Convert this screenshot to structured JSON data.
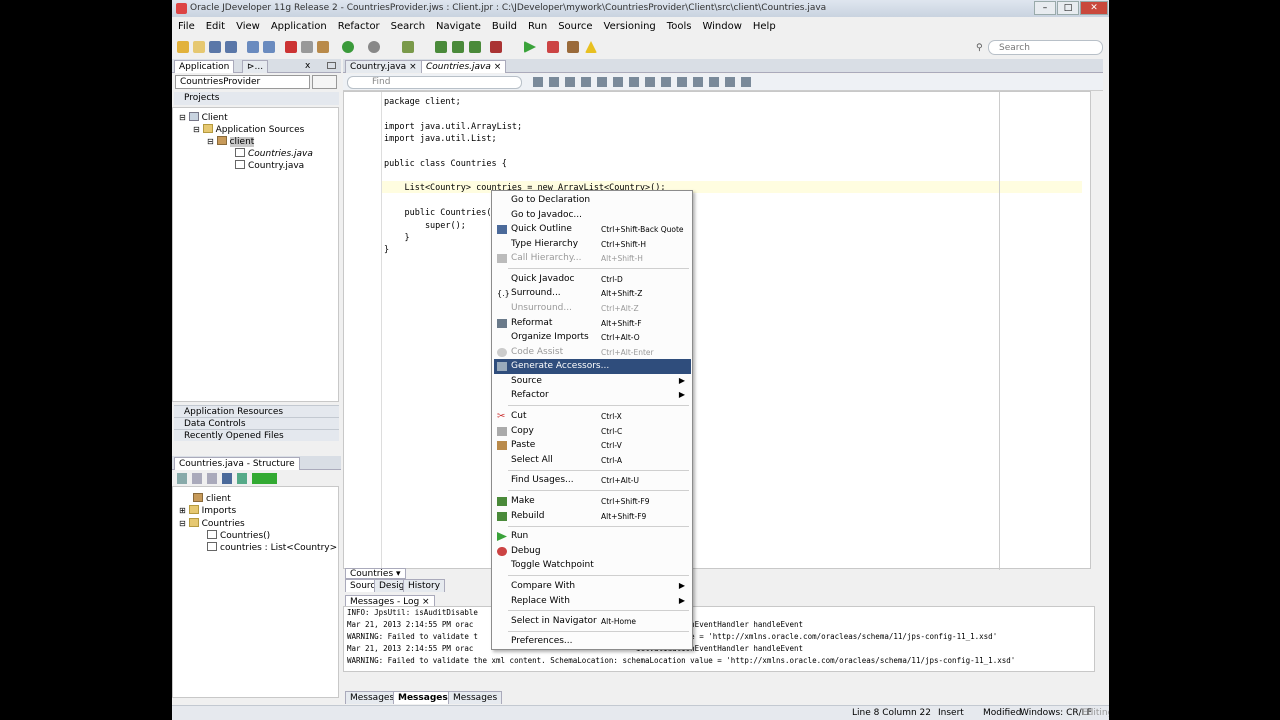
{
  "window": {
    "title": "Oracle JDeveloper 11g Release 2 - CountriesProvider.jws : Client.jpr : C:\\JDeveloper\\mywork\\CountriesProvider\\Client\\src\\client\\Countries.java",
    "min": "–",
    "max": "□",
    "close": "✕"
  },
  "menubar": [
    "File",
    "Edit",
    "View",
    "Application",
    "Refactor",
    "Search",
    "Navigate",
    "Build",
    "Run",
    "Source",
    "Versioning",
    "Tools",
    "Window",
    "Help"
  ],
  "search": {
    "placeholder": "Search",
    "icon": "magnifier-icon"
  },
  "left": {
    "tabs": [
      "Application",
      "⊳...",
      "x"
    ],
    "app_combo": "CountriesProvider",
    "projects_label": "Projects",
    "tree": [
      {
        "label": "Client"
      },
      {
        "label": "Application Sources"
      },
      {
        "label": "client"
      },
      {
        "label": "Countries.java"
      },
      {
        "label": "Country.java"
      }
    ],
    "accordions": [
      "Application Resources",
      "Data Controls",
      "Recently Opened Files"
    ]
  },
  "structure": {
    "tab": "Countries.java - Structure",
    "tree": [
      {
        "label": "client"
      },
      {
        "label": "Imports"
      },
      {
        "label": "Countries"
      },
      {
        "label": "Countries()"
      },
      {
        "label": "countries : List<Country>"
      }
    ]
  },
  "editor": {
    "tabs": [
      "Country.java",
      "Countries.java"
    ],
    "find_placeholder": "Find",
    "lines": [
      "package client;",
      "",
      "import java.util.ArrayList;",
      "import java.util.List;",
      "",
      "public class Countries {",
      "",
      "    List<Country> countries = new ArrayList<Country>();",
      "",
      "    public Countries() {",
      "        super();",
      "    }",
      "}"
    ],
    "breadcrumb": "Countries",
    "view_tabs": [
      "Source",
      "Design",
      "History"
    ]
  },
  "context_menu": [
    {
      "label": "Go to Declaration",
      "shortcut": "",
      "enabled": true
    },
    {
      "label": "Go to Javadoc...",
      "shortcut": "",
      "enabled": true
    },
    {
      "label": "Quick Outline",
      "shortcut": "Ctrl+Shift-Back Quote",
      "enabled": true
    },
    {
      "label": "Type Hierarchy",
      "shortcut": "Ctrl+Shift-H",
      "enabled": true
    },
    {
      "label": "Call Hierarchy...",
      "shortcut": "Alt+Shift-H",
      "enabled": false
    },
    {
      "label": "Quick Javadoc",
      "shortcut": "Ctrl-D",
      "enabled": true
    },
    {
      "label": "Surround...",
      "shortcut": "Alt+Shift-Z",
      "enabled": true
    },
    {
      "label": "Unsurround...",
      "shortcut": "Ctrl+Alt-Z",
      "enabled": false
    },
    {
      "label": "Reformat",
      "shortcut": "Alt+Shift-F",
      "enabled": true
    },
    {
      "label": "Organize Imports",
      "shortcut": "Ctrl+Alt-O",
      "enabled": true
    },
    {
      "label": "Code Assist",
      "shortcut": "Ctrl+Alt-Enter",
      "enabled": false
    },
    {
      "label": "Generate Accessors...",
      "shortcut": "",
      "enabled": true
    },
    {
      "label": "Source",
      "shortcut": "",
      "enabled": true
    },
    {
      "label": "Refactor",
      "shortcut": "",
      "enabled": true
    },
    {
      "label": "Cut",
      "shortcut": "Ctrl-X",
      "enabled": true
    },
    {
      "label": "Copy",
      "shortcut": "Ctrl-C",
      "enabled": true
    },
    {
      "label": "Paste",
      "shortcut": "Ctrl-V",
      "enabled": true
    },
    {
      "label": "Select All",
      "shortcut": "Ctrl-A",
      "enabled": true
    },
    {
      "label": "Find Usages...",
      "shortcut": "Ctrl+Alt-U",
      "enabled": true
    },
    {
      "label": "Make",
      "shortcut": "Ctrl+Shift-F9",
      "enabled": true
    },
    {
      "label": "Rebuild",
      "shortcut": "Alt+Shift-F9",
      "enabled": true
    },
    {
      "label": "Run",
      "shortcut": "",
      "enabled": true
    },
    {
      "label": "Debug",
      "shortcut": "",
      "enabled": true
    },
    {
      "label": "Toggle Watchpoint",
      "shortcut": "",
      "enabled": true
    },
    {
      "label": "Compare With",
      "shortcut": "",
      "enabled": true
    },
    {
      "label": "Replace With",
      "shortcut": "",
      "enabled": true
    },
    {
      "label": "Select in Navigator",
      "shortcut": "Alt-Home",
      "enabled": true
    },
    {
      "label": "Preferences...",
      "shortcut": "",
      "enabled": true
    }
  ],
  "messages": {
    "tab": "Messages - Log",
    "lines": [
      "INFO: JpsUtil: isAuditDisable",
      "Mar 21, 2013 2:14:55 PM orac                                    ictValidationEventHandler handleEvent",
      "WARNING: Failed to validate t                                   ocation value = 'http://xmlns.oracle.com/oracleas/schema/11/jps-config-11_1.xsd'",
      "Mar 21, 2013 2:14:55 PM orac                                    ictValidationEventHandler handleEvent",
      "WARNING: Failed to validate the xml content. SchemaLocation: schemaLocation value = 'http://xmlns.oracle.com/oracleas/schema/11/jps-config-11_1.xsd'"
    ],
    "bottom_tabs": [
      "Messages",
      "Messages",
      "Messages"
    ]
  },
  "status": {
    "position": "Line 8 Column 22",
    "mode": "Insert",
    "state": "Modified",
    "eol": "Windows: CR/LF",
    "edit": "Editing"
  }
}
